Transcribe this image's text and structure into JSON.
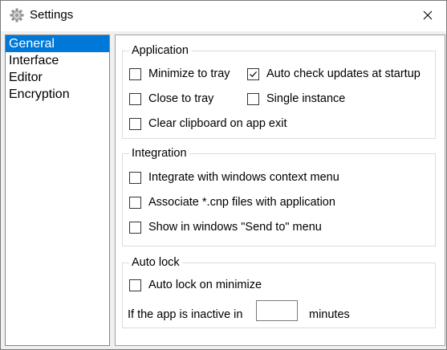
{
  "window": {
    "title": "Settings"
  },
  "sidebar": {
    "items": [
      {
        "label": "General"
      },
      {
        "label": "Interface"
      },
      {
        "label": "Editor"
      },
      {
        "label": "Encryption"
      }
    ],
    "selected": "General"
  },
  "application": {
    "title": "Application",
    "minimize_to_tray": {
      "label": "Minimize to tray",
      "checked": false
    },
    "auto_check_updates": {
      "label": "Auto check updates at startup",
      "checked": true
    },
    "close_to_tray": {
      "label": "Close to tray",
      "checked": false
    },
    "single_instance": {
      "label": "Single instance",
      "checked": false
    },
    "clear_clipboard": {
      "label": "Clear clipboard on app exit",
      "checked": false
    }
  },
  "integration": {
    "title": "Integration",
    "context_menu": {
      "label": "Integrate with windows context menu",
      "checked": false
    },
    "associate_files": {
      "label": "Associate *.cnp files with application",
      "checked": false
    },
    "send_to_menu": {
      "label": "Show in windows \"Send to\" menu",
      "checked": false
    }
  },
  "auto_lock": {
    "title": "Auto lock",
    "lock_on_minimize": {
      "label": "Auto lock on minimize",
      "checked": false
    },
    "inactive_label": "If the app is inactive in",
    "minutes_value": "",
    "minutes_label": "minutes"
  },
  "colors": {
    "selection": "#0078d7"
  }
}
